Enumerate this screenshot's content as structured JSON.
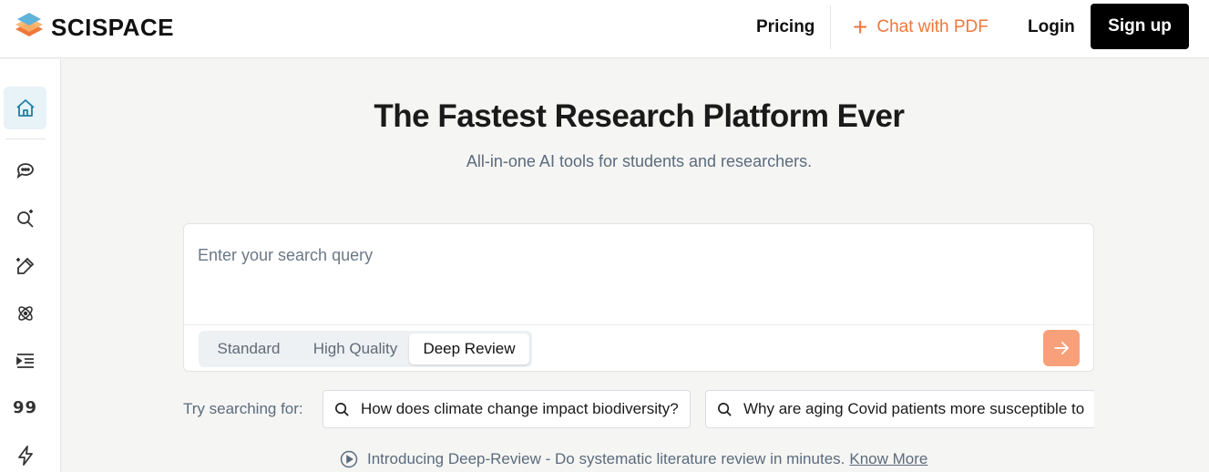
{
  "header": {
    "brand": "SCISPACE",
    "pricing_label": "Pricing",
    "chat_pdf_label": "Chat with PDF",
    "login_label": "Login",
    "signup_label": "Sign up",
    "chat_pdf_color": "#f0773b"
  },
  "sidebar": {
    "items": [
      {
        "icon": "home-icon",
        "active": true
      },
      {
        "icon": "chat-icon"
      },
      {
        "icon": "search-sparkle-icon"
      },
      {
        "icon": "pen-sparkle-icon"
      },
      {
        "icon": "atom-icon"
      },
      {
        "icon": "indent-list-icon"
      },
      {
        "icon": "quote-icon",
        "text": "99"
      },
      {
        "icon": "lightning-icon"
      }
    ]
  },
  "main": {
    "title": "The Fastest Research Platform Ever",
    "subtitle": "All-in-one AI tools for students and researchers.",
    "search": {
      "placeholder": "Enter your search query",
      "modes": [
        "Standard",
        "High Quality",
        "Deep Review"
      ],
      "active_mode": "Deep Review",
      "submit_color": "#f8a07a"
    },
    "suggestions": {
      "label": "Try searching for:",
      "items": [
        "How does climate change impact biodiversity?",
        "Why are aging Covid patients more susceptible to"
      ]
    },
    "intro": {
      "text": "Introducing Deep-Review - Do systematic literature review in minutes.",
      "link": "Know More"
    }
  }
}
